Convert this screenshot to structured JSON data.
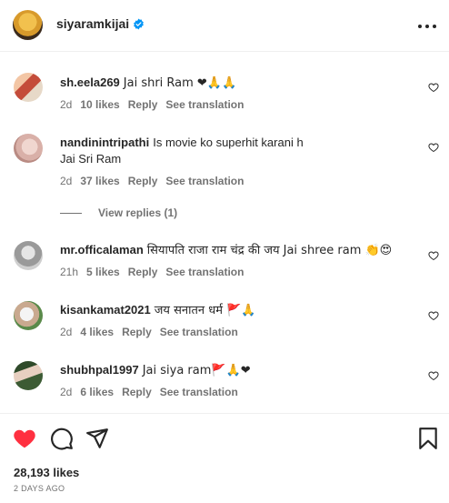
{
  "header": {
    "username": "siyaramkijai",
    "more_icon": "more-horizontal-icon"
  },
  "comments": [
    {
      "username": "sh.eela269",
      "text": "Jai shri Ram ❤︎🙏🙏",
      "age": "2d",
      "likes": "10 likes",
      "reply": "Reply",
      "translate": "See translation"
    },
    {
      "username": "nandinintripathi",
      "text": "Is movie ko superhit karani h",
      "text2": "Jai Sri Ram",
      "age": "2d",
      "likes": "37 likes",
      "reply": "Reply",
      "translate": "See translation"
    },
    {
      "username": "mr.officalaman",
      "text": "सियापति राजा राम चंद्र की जय Jai shree ram 👏😍",
      "age": "21h",
      "likes": "5 likes",
      "reply": "Reply",
      "translate": "See translation"
    },
    {
      "username": "kisankamat2021",
      "text": "जय सनातन धर्म 🚩🙏",
      "age": "2d",
      "likes": "4 likes",
      "reply": "Reply",
      "translate": "See translation"
    },
    {
      "username": "shubhpal1997",
      "text": "Jai siya ram🚩🙏❤︎",
      "age": "2d",
      "likes": "6 likes",
      "reply": "Reply",
      "translate": "See translation"
    }
  ],
  "view_replies": "View replies (1)",
  "post": {
    "likes": "28,193 likes",
    "time_ago": "2 DAYS AGO"
  },
  "colors": {
    "like_red": "#ff3040",
    "verified_blue": "#0095f6",
    "muted": "#737373"
  }
}
